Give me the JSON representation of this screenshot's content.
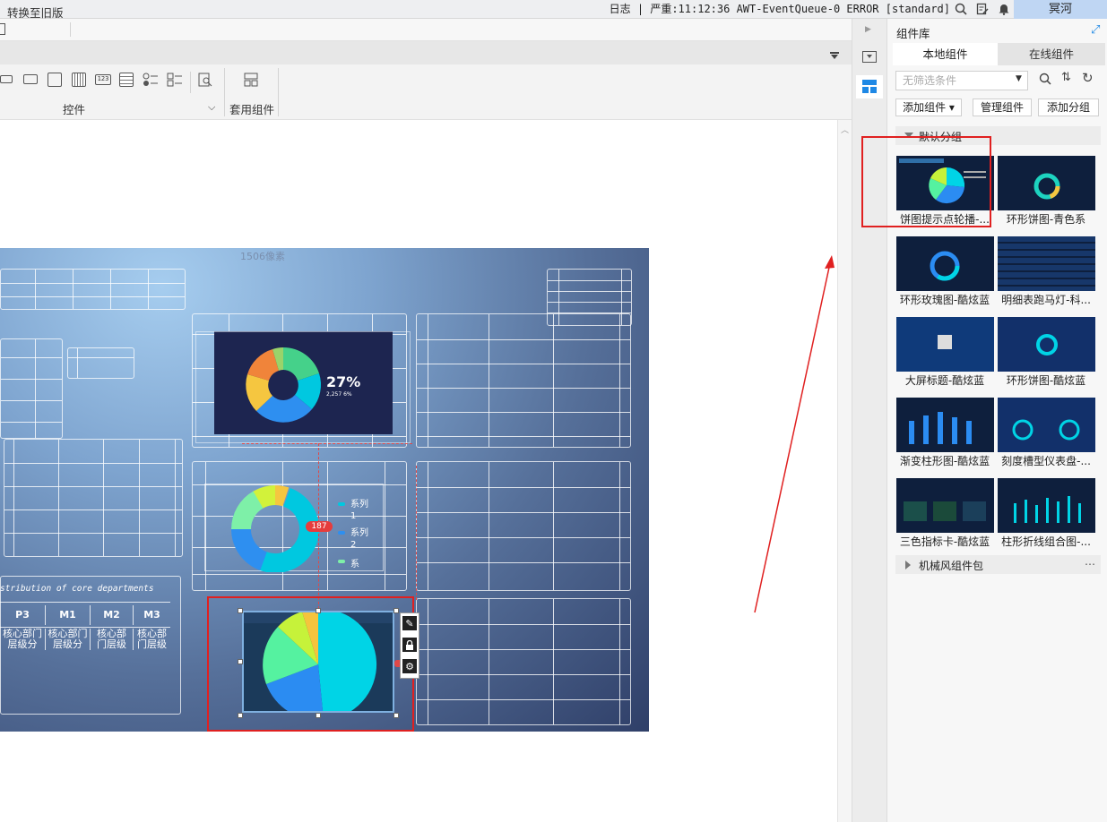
{
  "status_bar": {
    "log_text": "日志 | 严重:11:12:36 AWT-EventQueue-0 ERROR [standard]",
    "user_name": "冥河"
  },
  "toolbar": {
    "legacy_switch_label": "转换至旧版",
    "widgets_group_label": "控件",
    "used_widgets_label": "套用组件",
    "ribbon_icons": [
      "button-icon",
      "combobox-icon",
      "form-icon",
      "calendar-icon",
      "number-icon",
      "list-icon",
      "radio-icon",
      "checkbox-icon",
      "search-icon"
    ]
  },
  "canvas": {
    "size_label": "1506像素",
    "chart1_percent": "27%",
    "chart1_percent_sub": "2,257 6%",
    "chart2_legend": [
      "系列1",
      "系列2",
      "系"
    ],
    "badge_text": "187",
    "table_title": "stribution of core departments",
    "table_headers": [
      "P3",
      "M1",
      "M2",
      "M3"
    ],
    "table_cells": [
      "核心部门\n层级分",
      "核心部门\n层级分",
      "核心部\n门层级",
      "核心部\n门层级"
    ],
    "pie_colors": [
      "#00d4e6",
      "#2b8cf2",
      "#55f2a0",
      "#c6f23a",
      "#f5c43d"
    ],
    "donut_colors": [
      "#2e8ff0",
      "#00c8e0",
      "#45d18a",
      "#f0843a",
      "#f5c640",
      "#9ad36a"
    ]
  },
  "component_library": {
    "title": "组件库",
    "tabs": [
      "本地组件",
      "在线组件"
    ],
    "filter_placeholder": "无筛选条件",
    "buttons": [
      "添加组件 ▾",
      "管理组件",
      "添加分组"
    ],
    "group_default": "默认分组",
    "group_mechanical": "机械风组件包",
    "items": [
      {
        "name": "饼图提示点轮播-...",
        "thumb": "pie"
      },
      {
        "name": "环形饼图-青色系",
        "thumb": "ring-cyan"
      },
      {
        "name": "环形玫瑰图-酷炫蓝",
        "thumb": "ring-rose"
      },
      {
        "name": "明细表跑马灯-科...",
        "thumb": "table"
      },
      {
        "name": "大屏标题-酷炫蓝",
        "thumb": "title"
      },
      {
        "name": "环形饼图-酷炫蓝",
        "thumb": "ring-blue"
      },
      {
        "name": "渐变柱形图-酷炫蓝",
        "thumb": "bars"
      },
      {
        "name": "刻度槽型仪表盘-...",
        "thumb": "gauges"
      },
      {
        "name": "三色指标卡-酷炫蓝",
        "thumb": "kpi"
      },
      {
        "name": "柱形折线组合图-...",
        "thumb": "combo"
      }
    ]
  }
}
